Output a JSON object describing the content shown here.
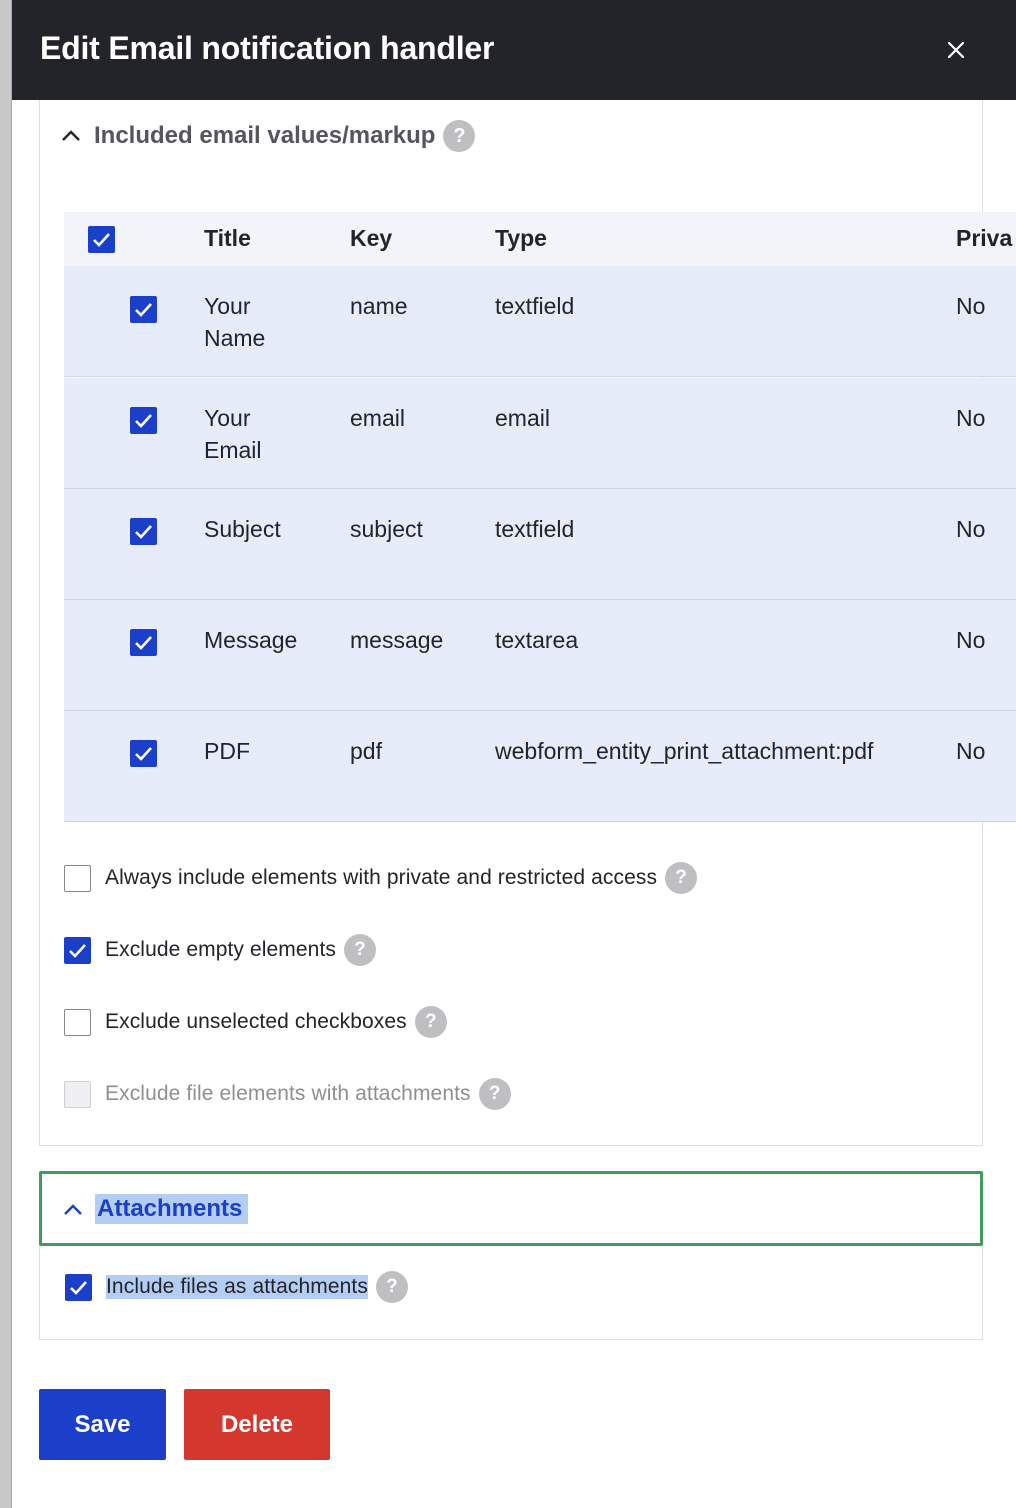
{
  "dialog": {
    "title": "Edit Email notification handler"
  },
  "values_section": {
    "summary": "Included email values/markup",
    "table": {
      "headers": {
        "title": "Title",
        "key": "Key",
        "type": "Type",
        "private": "Priva"
      },
      "rows": [
        {
          "title_line1": "Your",
          "title_line2": "Name",
          "key": "name",
          "type": "textfield",
          "private": "No",
          "checked": true
        },
        {
          "title_line1": "Your",
          "title_line2": "Email",
          "key": "email",
          "type": "email",
          "private": "No",
          "checked": true
        },
        {
          "title_line1": "Subject",
          "title_line2": "",
          "key": "subject",
          "type": "textfield",
          "private": "No",
          "checked": true
        },
        {
          "title_line1": "Message",
          "title_line2": "",
          "key": "message",
          "type": "textarea",
          "private": "No",
          "checked": true
        },
        {
          "title_line1": "PDF",
          "title_line2": "",
          "key": "pdf",
          "type": "webform_entity_print_attachment:pdf",
          "private": "No",
          "checked": true
        }
      ]
    },
    "options": [
      {
        "label": "Always include elements with private and restricted access",
        "checked": false,
        "disabled": false
      },
      {
        "label": "Exclude empty elements",
        "checked": true,
        "disabled": false
      },
      {
        "label": "Exclude unselected checkboxes",
        "checked": false,
        "disabled": false
      },
      {
        "label": "Exclude file elements with attachments",
        "checked": false,
        "disabled": true
      }
    ]
  },
  "attachments_section": {
    "summary": "Attachments",
    "option": {
      "label": "Include files as attachments",
      "checked": true
    }
  },
  "actions": {
    "save": "Save",
    "delete": "Delete"
  },
  "colors": {
    "primary": "#1b3fc9",
    "danger": "#d3372d",
    "focus": "#3f9c5c",
    "header": "#232429"
  }
}
